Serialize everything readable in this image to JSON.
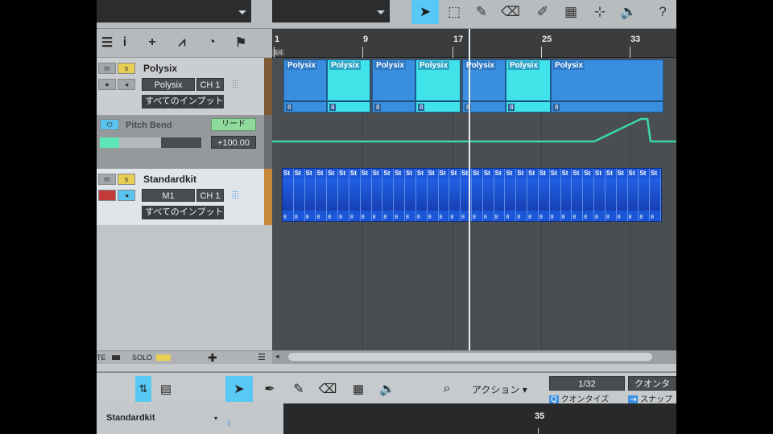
{
  "ruler": {
    "bars": [
      "1",
      "9",
      "17",
      "25",
      "33"
    ],
    "time_signature": "4/4"
  },
  "tracks": [
    {
      "name": "Polysix",
      "mute_label": "m",
      "solo_label": "s",
      "instrument": "Polysix",
      "channel": "CH 1",
      "input": "すべてのインプット"
    },
    {
      "name": "Standardkit",
      "mute_label": "m",
      "solo_label": "s",
      "instrument": "M1",
      "channel": "CH 1",
      "input": "すべてのインプット"
    }
  ],
  "automation": {
    "name": "Pitch Bend",
    "mode": "リード",
    "value": "+100.00"
  },
  "polysix_clips": [
    {
      "label": "Polysix",
      "num": "8"
    },
    {
      "label": "Polysix",
      "num": "8"
    },
    {
      "label": "Polysix",
      "num": "8"
    },
    {
      "label": "Polysix",
      "num": "8"
    },
    {
      "label": "Polysix",
      "num": "8"
    },
    {
      "label": "Polysix",
      "num": "8"
    },
    {
      "label": "Polysix",
      "num": "8"
    }
  ],
  "drum_label": "St",
  "statusbar": {
    "mute": "TE",
    "solo": "SOLO"
  },
  "lower": {
    "action": "アクション",
    "quantize_value": "1/32",
    "quantize_label": "クオンタイズ",
    "snap_label": "スナップ",
    "quantize_header": "クオンタ",
    "track_select": "Standardkit",
    "ruler_bar": "35"
  },
  "colors": {
    "accent": "#58c8f4",
    "clip_blue": "#3a8ee0",
    "clip_cyan": "#3fe3e8",
    "drum_blue": "#1b56d6",
    "automation_line": "#3ad8a4",
    "solo_yellow": "#e8cf54",
    "track_color_orange": "#c9893a"
  },
  "icons": {
    "top_toolbar": [
      "arrow-icon",
      "range-icon",
      "pencil-icon",
      "eraser-icon",
      "paint-icon",
      "mute-tool-icon",
      "split-icon",
      "speaker-icon",
      "help-icon"
    ],
    "header_tools": [
      "list-icon",
      "info-icon",
      "add-icon",
      "automation-icon",
      "clock-icon",
      "flag-icon"
    ]
  }
}
